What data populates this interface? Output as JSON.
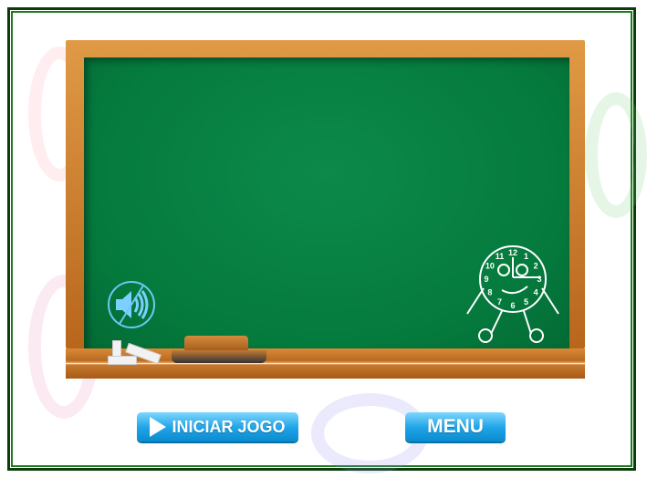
{
  "buttons": {
    "start_label": "INICIAR JOGO",
    "menu_label": "MENU"
  },
  "sound": {
    "icon": "speaker-muted-icon",
    "muted": true
  },
  "clock": {
    "numbers": [
      "12",
      "1",
      "2",
      "3",
      "4",
      "5",
      "6",
      "7",
      "8",
      "9",
      "10",
      "11"
    ]
  },
  "colors": {
    "board": "#057a3d",
    "frame": "#c47627",
    "button": "#22a6e8",
    "border": "#0b3d0b"
  }
}
